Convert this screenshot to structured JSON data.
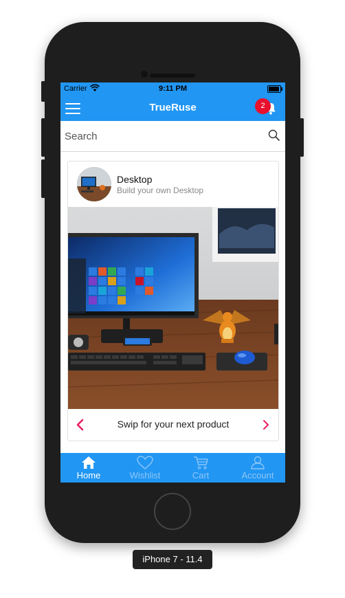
{
  "status_bar": {
    "carrier": "Carrier",
    "time": "9:11 PM"
  },
  "nav": {
    "title": "TrueRuse",
    "notification_count": "2"
  },
  "search": {
    "placeholder": "Search",
    "value": ""
  },
  "card": {
    "title": "Desktop",
    "subtitle": "Build your own Desktop",
    "footer_text": "Swip for your next product"
  },
  "tabs": [
    {
      "label": "Home",
      "icon": "home-icon",
      "active": true
    },
    {
      "label": "Wishlist",
      "icon": "heart-icon",
      "active": false
    },
    {
      "label": "Cart",
      "icon": "cart-icon",
      "active": false
    },
    {
      "label": "Account",
      "icon": "user-icon",
      "active": false
    }
  ],
  "device_label": "iPhone 7 - 11.4",
  "colors": {
    "primary": "#2196f3",
    "badge": "#e8102d",
    "chevron": "#e91e63"
  }
}
